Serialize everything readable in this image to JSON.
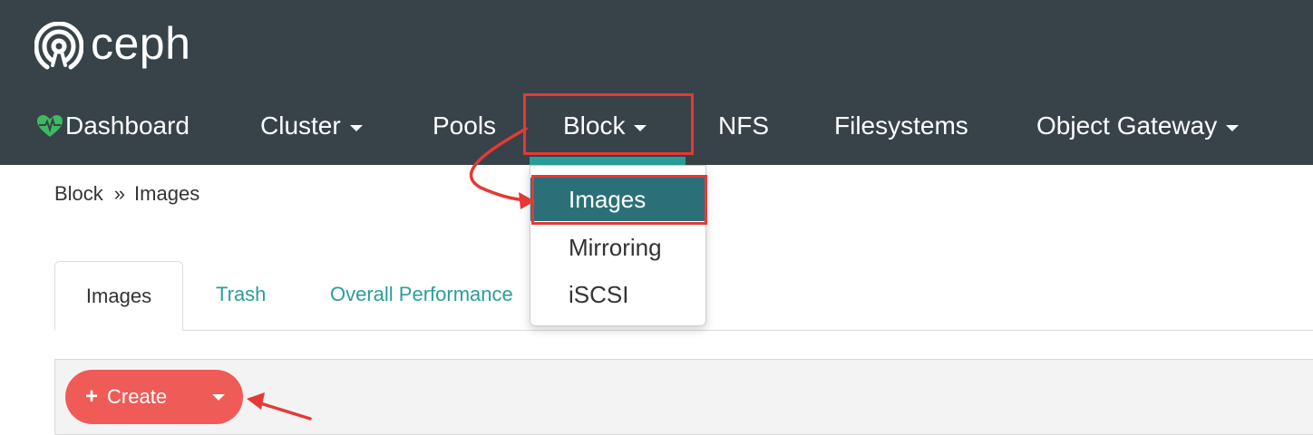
{
  "app": {
    "name": "ceph",
    "brand_logo": "ceph-logo-icon"
  },
  "nav": {
    "dashboard": "Dashboard",
    "cluster": "Cluster",
    "pools": "Pools",
    "block": "Block",
    "nfs": "NFS",
    "filesystems": "Filesystems",
    "object_gateway": "Object Gateway",
    "dashboard_icon": "heartbeat-icon"
  },
  "block_menu": {
    "items": [
      "Images",
      "Mirroring",
      "iSCSI"
    ],
    "active": "Images"
  },
  "breadcrumb": {
    "parent": "Block",
    "separator": "»",
    "current": "Images"
  },
  "tabs": {
    "images": "Images",
    "trash": "Trash",
    "overall_performance": "Overall Performance"
  },
  "toolbar": {
    "create_label": "Create",
    "create_icon": "plus-icon"
  },
  "colors": {
    "header_bg": "#374249",
    "accent_teal": "#2a9e9b",
    "active_menu": "#2b7079",
    "create_button": "#ef5b57",
    "annotation": "#e53935",
    "heartbeat": "#3dbb62"
  }
}
